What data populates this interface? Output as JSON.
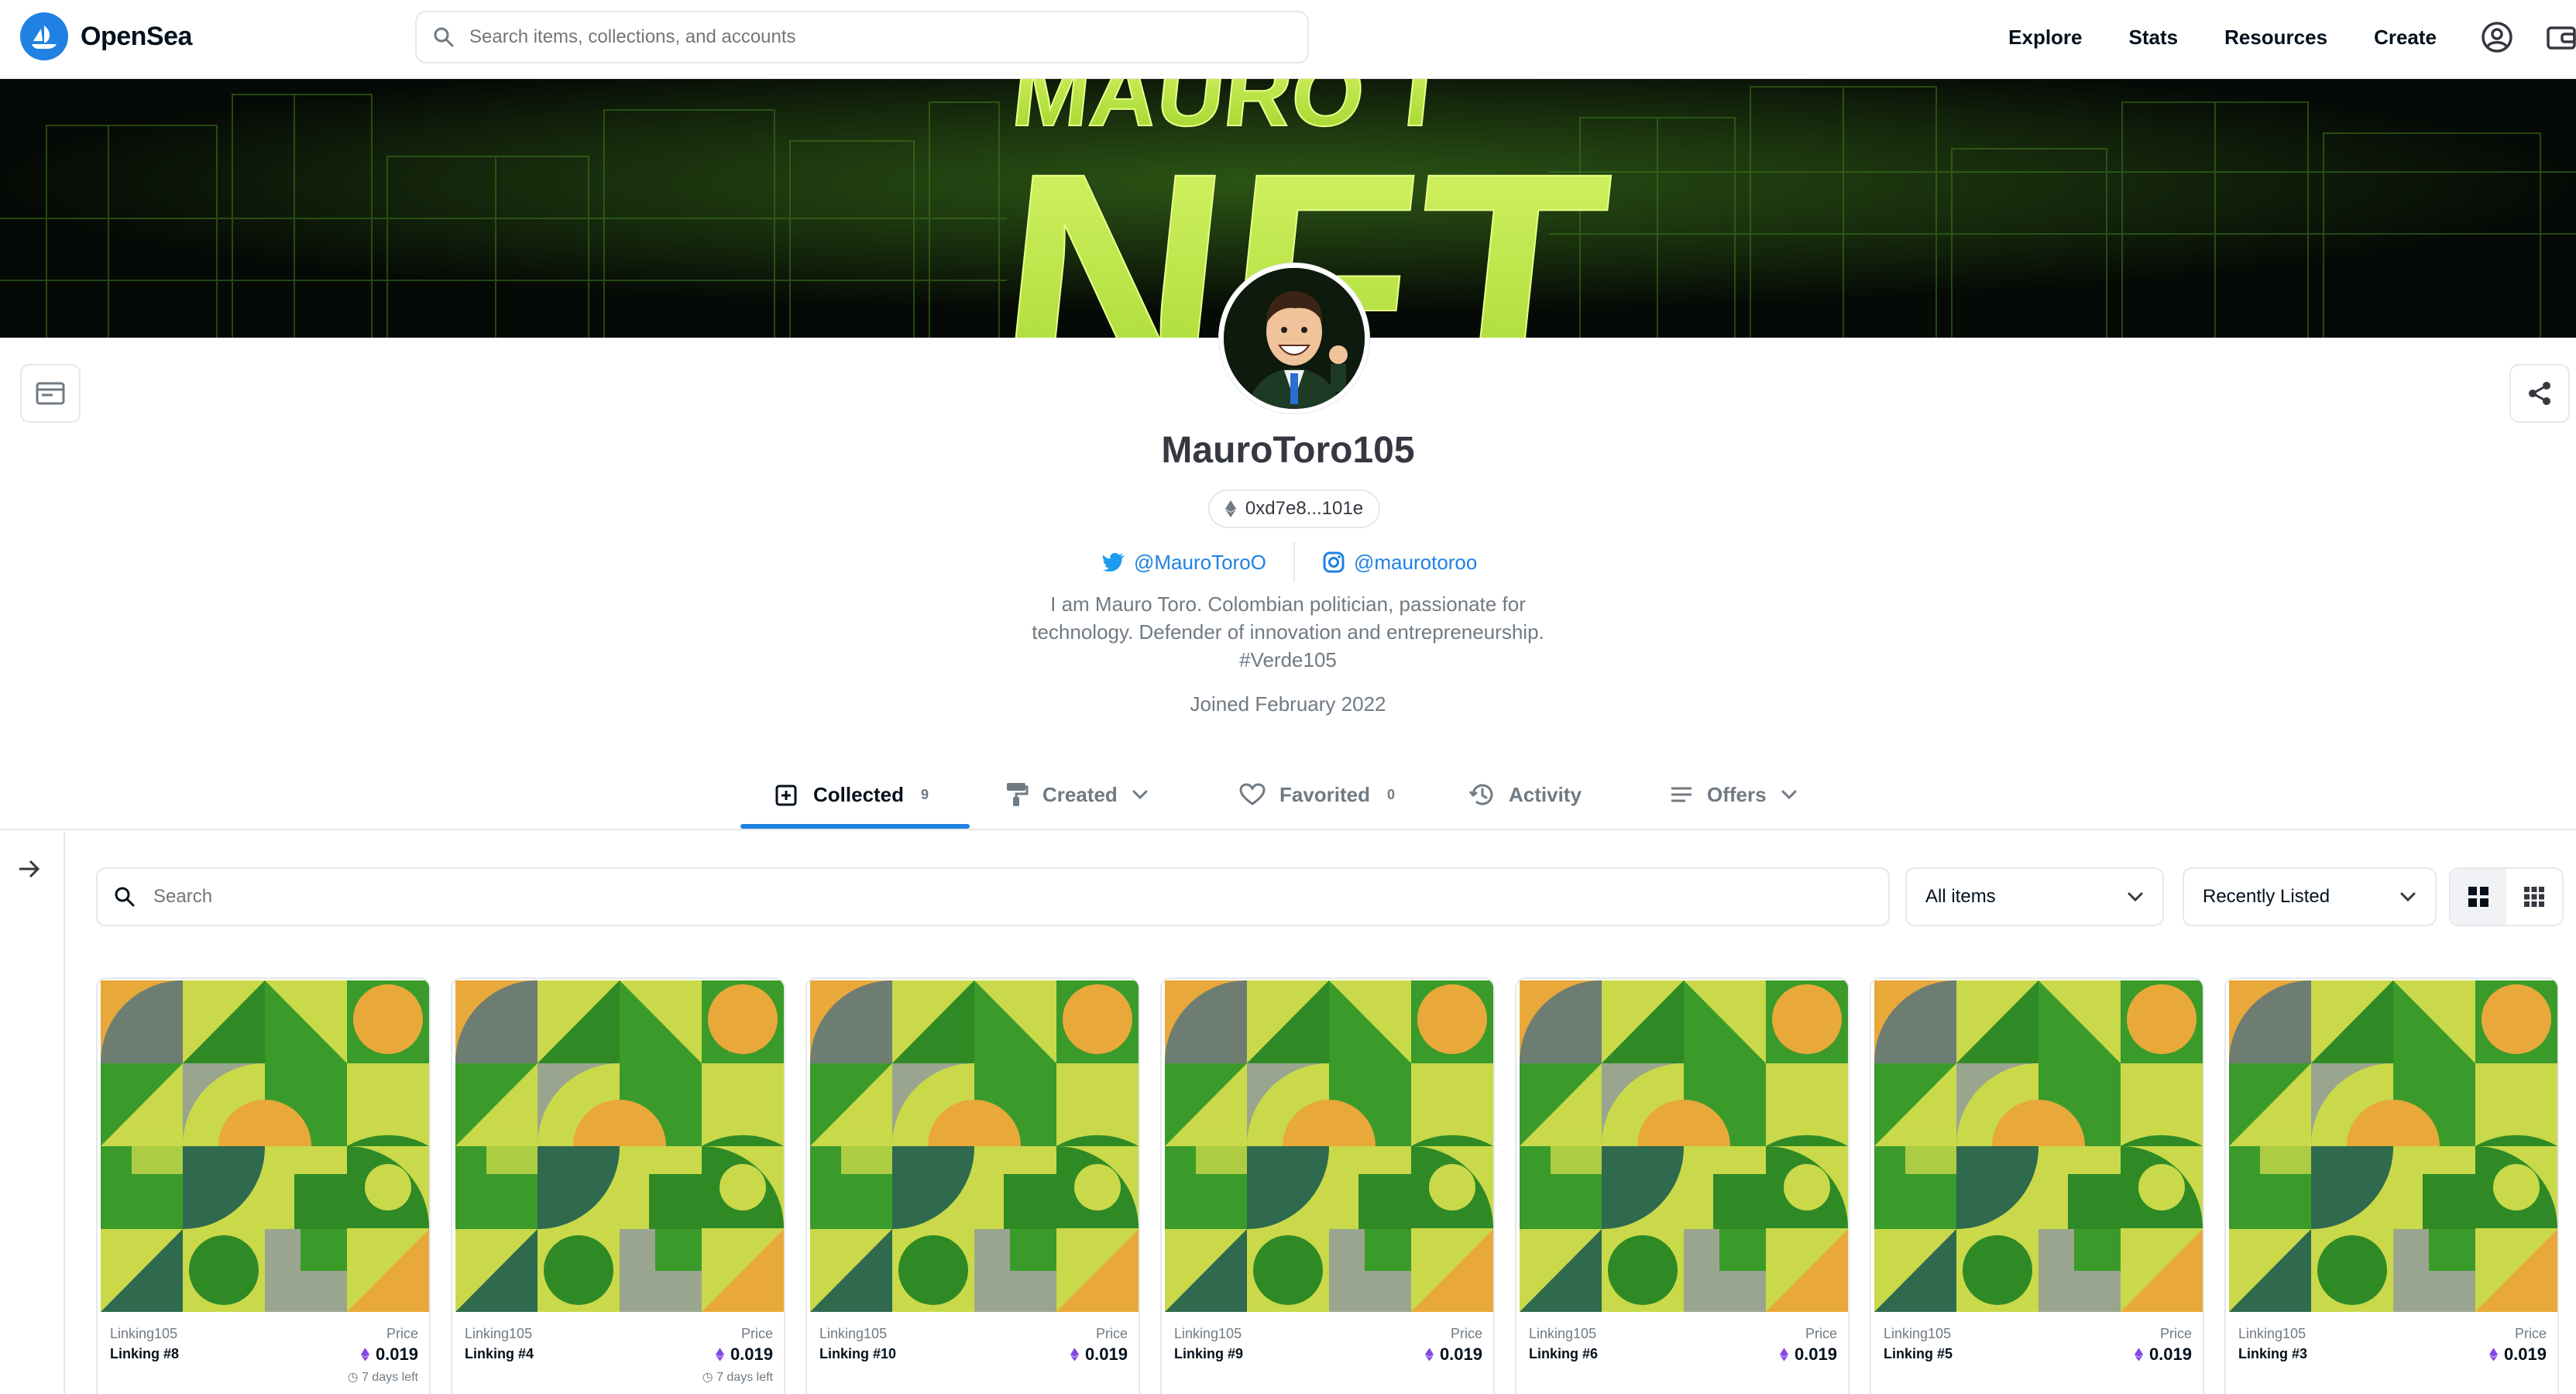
{
  "header": {
    "brand": "OpenSea",
    "search_placeholder": "Search items, collections, and accounts",
    "nav": [
      "Explore",
      "Stats",
      "Resources",
      "Create"
    ]
  },
  "banner": {
    "text": "NFT",
    "upper_text": "MAURO T"
  },
  "profile": {
    "name": "MauroToro105",
    "address": "0xd7e8...101e",
    "twitter": "@MauroToroO",
    "instagram": "@maurotoroo",
    "bio_lines": [
      "I am Mauro Toro. Colombian politician, passionate for",
      "technology. Defender of innovation and entrepreneurship.",
      "#Verde105"
    ],
    "joined": "Joined February 2022"
  },
  "tabs": [
    {
      "label": "Collected",
      "count": "9"
    },
    {
      "label": "Created",
      "count": ""
    },
    {
      "label": "Favorited",
      "count": "0"
    },
    {
      "label": "Activity",
      "count": ""
    },
    {
      "label": "Offers",
      "count": ""
    }
  ],
  "filters": {
    "search_placeholder": "Search",
    "items_select": "All items",
    "sort_select": "Recently Listed"
  },
  "cards": [
    {
      "collection": "Linking105",
      "name": "Linking #8",
      "price_label": "Price",
      "price": "0.019",
      "time": "7 days left"
    },
    {
      "collection": "Linking105",
      "name": "Linking #4",
      "price_label": "Price",
      "price": "0.019",
      "time": "7 days left"
    },
    {
      "collection": "Linking105",
      "name": "Linking #10",
      "price_label": "Price",
      "price": "0.019",
      "time": ""
    },
    {
      "collection": "Linking105",
      "name": "Linking #9",
      "price_label": "Price",
      "price": "0.019",
      "time": ""
    },
    {
      "collection": "Linking105",
      "name": "Linking #6",
      "price_label": "Price",
      "price": "0.019",
      "time": ""
    },
    {
      "collection": "Linking105",
      "name": "Linking #5",
      "price_label": "Price",
      "price": "0.019",
      "time": ""
    },
    {
      "collection": "Linking105",
      "name": "Linking #3",
      "price_label": "Price",
      "price": "0.019",
      "time": ""
    }
  ],
  "colors": {
    "accent": "#2081e2",
    "neon": "#b8ec3c",
    "card_green": "#3a9b2a",
    "card_orange": "#e8a93a",
    "card_lime": "#c9d94a"
  }
}
